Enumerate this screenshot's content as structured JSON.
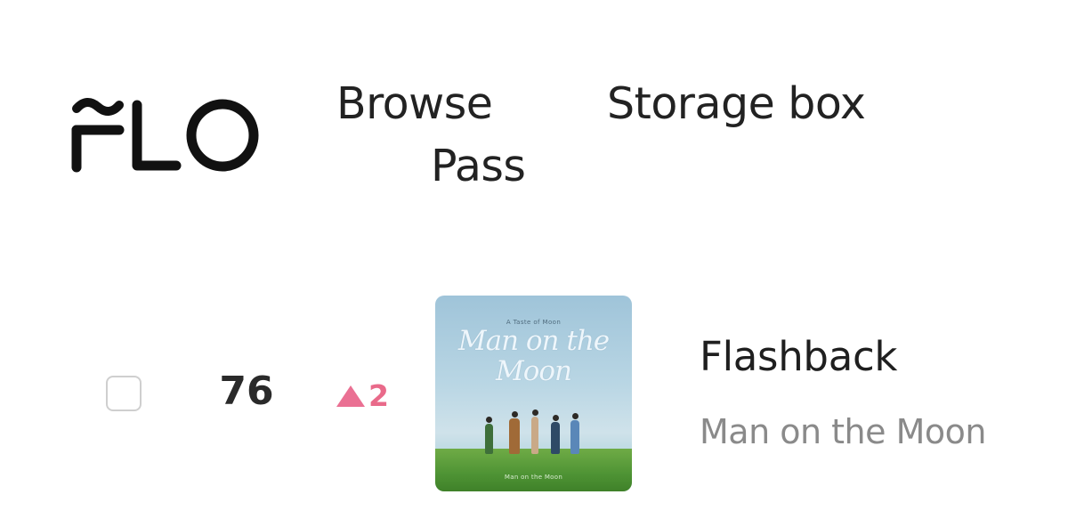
{
  "header": {
    "logo_text": "FLO",
    "nav": {
      "browse": "Browse",
      "storage_box": "Storage box",
      "pass": "Pass"
    }
  },
  "chart_row": {
    "checked": false,
    "rank": "76",
    "rank_change": {
      "direction": "up",
      "icon": "triangle-up-icon",
      "value": "2",
      "color": "#ea7093"
    },
    "album_cover": {
      "top_text": "A Taste of Moon",
      "title_line1": "Man on the",
      "title_line2": "Moon",
      "bottom_text": "Man on the Moon"
    },
    "title": "Flashback",
    "artist": "Man on the Moon"
  }
}
